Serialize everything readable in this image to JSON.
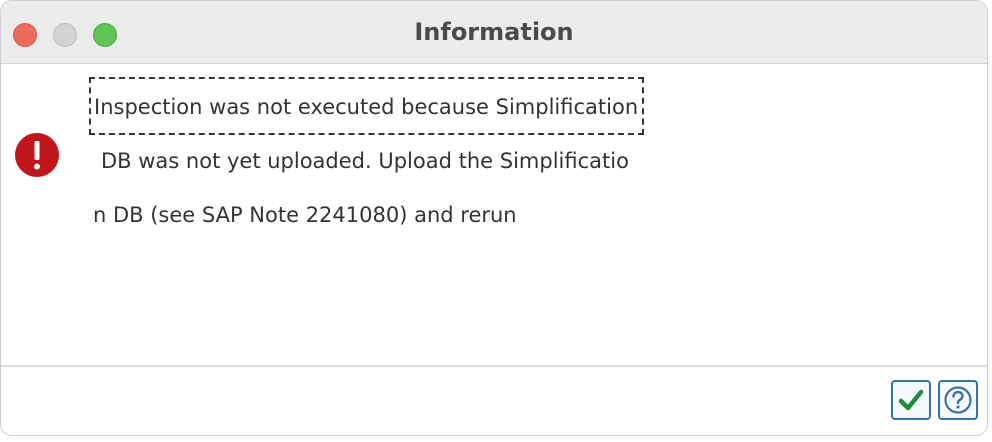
{
  "window": {
    "title": "Information"
  },
  "message": {
    "icon": "error-icon",
    "lines": [
      "Inspection was not executed because Simplification",
      "DB was not yet uploaded. Upload the Simplificatio",
      "n DB (see SAP Note 2241080) and rerun"
    ]
  },
  "footer": {
    "buttons": [
      {
        "name": "ok-button",
        "icon": "checkmark-icon"
      },
      {
        "name": "help-button",
        "icon": "question-icon"
      }
    ]
  },
  "colors": {
    "error_red": "#c0151b",
    "ok_green": "#1f8a3c",
    "button_border": "#3a72a8",
    "close_dot": "#ed6a5e",
    "minimize_dot": "#d3d3d3",
    "maximize_dot": "#5fc453"
  }
}
